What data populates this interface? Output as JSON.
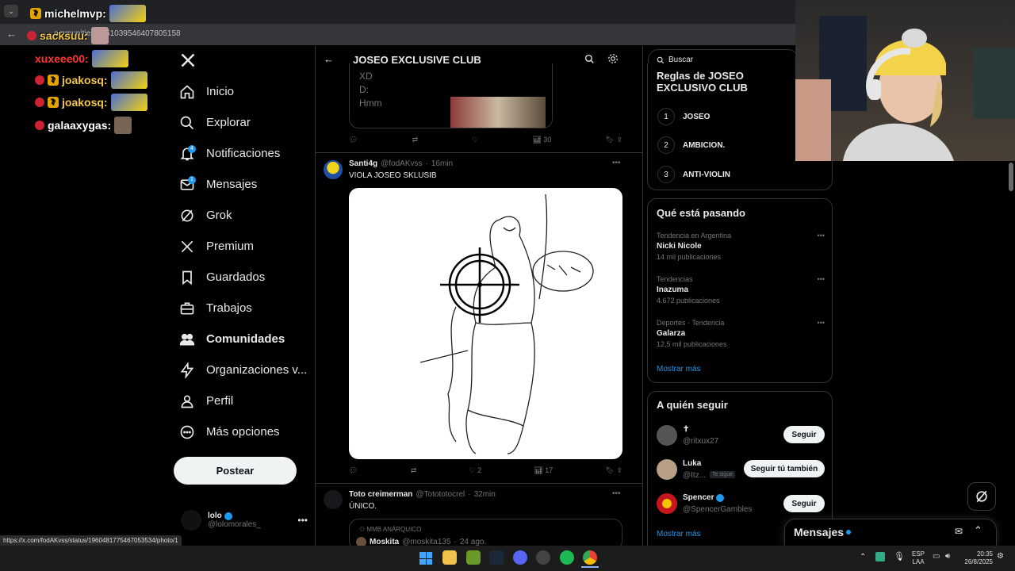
{
  "browser": {
    "url": "x.com/i/communities/1851039546407805158",
    "url_visible": "ommunities/1851039546407805158",
    "status_bar": "https://x.com/fodAKvss/status/1960481775467053534/photo/1"
  },
  "stream_chat": [
    {
      "user": "michelmvp:",
      "color": "#ffffff"
    },
    {
      "user": "sacksuu:",
      "color": "#f4c84a"
    },
    {
      "user": "xuxeee00:",
      "color": "#ff3333"
    },
    {
      "user": "joakosq:",
      "color": "#f4c84a"
    },
    {
      "user": "joakosq:",
      "color": "#f4c84a"
    },
    {
      "user": "galaaxygas:",
      "color": "#ffffff"
    }
  ],
  "nav": {
    "items": [
      {
        "label": "Inicio",
        "icon": "home-icon"
      },
      {
        "label": "Explorar",
        "icon": "search-icon"
      },
      {
        "label": "Notificaciones",
        "icon": "bell-icon",
        "badge": "4"
      },
      {
        "label": "Mensajes",
        "icon": "mail-icon",
        "badge": "1"
      },
      {
        "label": "Grok",
        "icon": "grok-icon"
      },
      {
        "label": "Premium",
        "icon": "x-icon"
      },
      {
        "label": "Guardados",
        "icon": "bookmark-icon"
      },
      {
        "label": "Trabajos",
        "icon": "briefcase-icon"
      },
      {
        "label": "Comunidades",
        "icon": "people-icon"
      },
      {
        "label": "Organizaciones v...",
        "icon": "lightning-icon"
      },
      {
        "label": "Perfil",
        "icon": "person-icon"
      },
      {
        "label": "Más opciones",
        "icon": "more-circle-icon"
      }
    ],
    "post_label": "Postear",
    "account": {
      "name": "lolo",
      "handle": "@lolomorales_"
    }
  },
  "feed": {
    "title": "JOSEO EXCLUSIVE CLUB",
    "prev_tweet": {
      "lines": [
        "XD",
        "D:",
        "Hmm"
      ],
      "views": "30"
    },
    "tweet1": {
      "name": "Santi4g",
      "handle": "@fodAKvss",
      "time": "16min",
      "text": "VIOLA JOSEO SKLUSIB",
      "likes": "2",
      "views": "17"
    },
    "tweet2": {
      "name": "Toto creimerman",
      "handle": "@Totototocrel",
      "time": "32min",
      "text": "ÚNICO.",
      "quote_label": "MMB ANÁRQUICO",
      "quote_name": "Moskita",
      "quote_handle": "@moskita135",
      "quote_time": "24 ago."
    }
  },
  "right": {
    "search_placeholder": "Buscar",
    "rules_title": "Reglas de JOSEO EXCLUSIVO CLUB",
    "rules": [
      {
        "n": "1",
        "text": "JOSEO"
      },
      {
        "n": "2",
        "text": "AMBICION."
      },
      {
        "n": "3",
        "text": "ANTI-VIOLIN"
      }
    ],
    "trends_title": "Qué está pasando",
    "trends": [
      {
        "context": "Tendencia en Argentina",
        "name": "Nicki Nicole",
        "count": "14 mil publicaciones"
      },
      {
        "context": "Tendencias",
        "name": "Inazuma",
        "count": "4.672 publicaciones"
      },
      {
        "context": "Deportes · Tendencia",
        "name": "Galarza",
        "count": "12,5 mil publicaciones"
      }
    ],
    "show_more": "Mostrar más",
    "follow_title": "A quién seguir",
    "follow": [
      {
        "name": "✝",
        "handle": "@ritxux27",
        "button": "Seguir"
      },
      {
        "name": "Luka",
        "handle": "@Itz...",
        "tag": "Te sigue",
        "button": "Seguir tú también"
      },
      {
        "name": "Spencer",
        "handle": "@SpencerGambles",
        "button": "Seguir"
      }
    ],
    "messages_label": "Mensajes"
  },
  "taskbar": {
    "lang1": "ESP",
    "lang2": "LAA",
    "time": "20:35",
    "date": "26/8/2025"
  }
}
